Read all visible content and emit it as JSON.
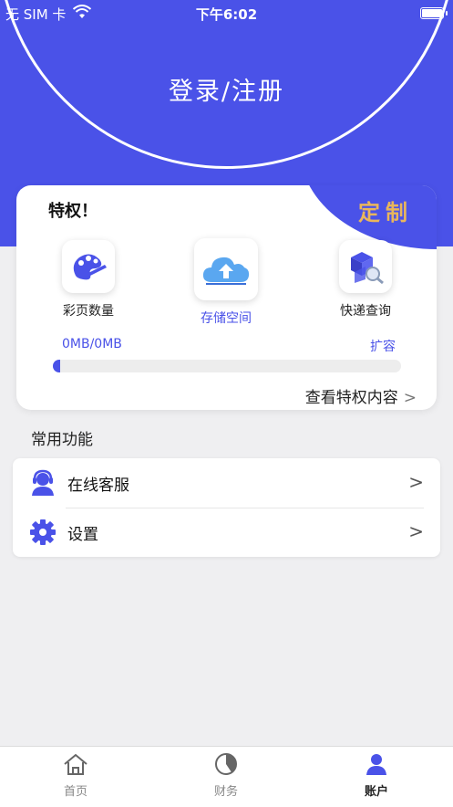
{
  "status": {
    "carrier": "无 SIM 卡",
    "time": "下午6:02"
  },
  "header": {
    "login": "登录/注册"
  },
  "privilege": {
    "title": "特权！",
    "custom": "定制",
    "features": [
      {
        "label": "彩页数量",
        "icon": "color-page-icon"
      },
      {
        "label": "存储空间",
        "icon": "cloud-storage-icon"
      },
      {
        "label": "快递查询",
        "icon": "express-query-icon"
      }
    ],
    "usage": "0MB/0MB",
    "usage_fraction": 0.02,
    "expand": "扩容",
    "view_more": "查看特权内容"
  },
  "section": {
    "title": "常用功能"
  },
  "menu": [
    {
      "label": "在线客服",
      "icon": "customer-service-icon"
    },
    {
      "label": "设置",
      "icon": "gear-icon"
    }
  ],
  "tabs": [
    {
      "label": "首页",
      "icon": "home-icon"
    },
    {
      "label": "财务",
      "icon": "pie-chart-icon"
    },
    {
      "label": "账户",
      "icon": "user-icon"
    }
  ],
  "colors": {
    "accent": "#4a52e8",
    "gold": "#e9b65c",
    "background": "#efeff1"
  }
}
